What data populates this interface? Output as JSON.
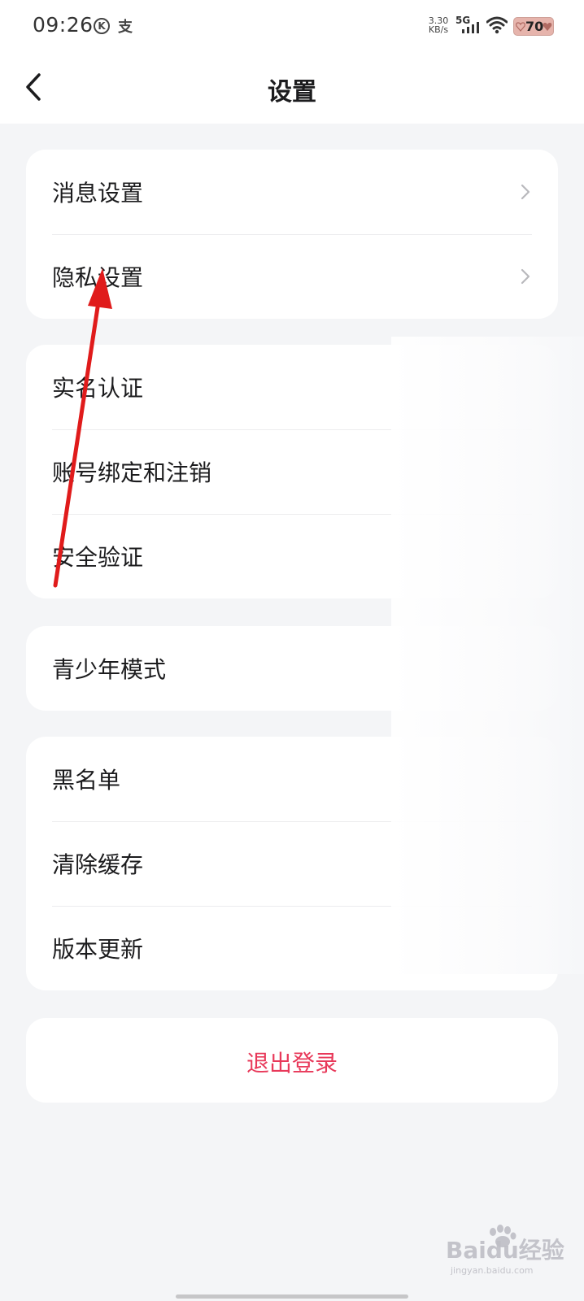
{
  "status_bar": {
    "time": "09:26",
    "k_icon_text": "K",
    "pay_icon_text": "支",
    "net_speed_value": "3.30",
    "net_speed_unit": "KB/s",
    "network_type": "5G",
    "battery_level": "70"
  },
  "header": {
    "title": "设置",
    "back_icon": "chevron-left-icon"
  },
  "groups": [
    {
      "items": [
        {
          "label": "消息设置",
          "has_chevron": true
        },
        {
          "label": "隐私设置",
          "has_chevron": true
        }
      ]
    },
    {
      "items": [
        {
          "label": "实名认证"
        },
        {
          "label": "账号绑定和注销"
        },
        {
          "label": "安全验证"
        }
      ]
    },
    {
      "items": [
        {
          "label": "青少年模式"
        }
      ]
    },
    {
      "items": [
        {
          "label": "黑名单"
        },
        {
          "label": "清除缓存"
        },
        {
          "label": "版本更新"
        }
      ]
    }
  ],
  "logout": {
    "label": "退出登录",
    "color": "#e8395a"
  },
  "annotation": {
    "arrow_color": "#e01b1b",
    "target": "隐私设置"
  },
  "watermark": {
    "brand": "Baidu经验",
    "url": "jingyan.baidu.com"
  },
  "colors": {
    "background": "#f4f5f7",
    "card": "#ffffff",
    "text": "#1c1c1e"
  }
}
